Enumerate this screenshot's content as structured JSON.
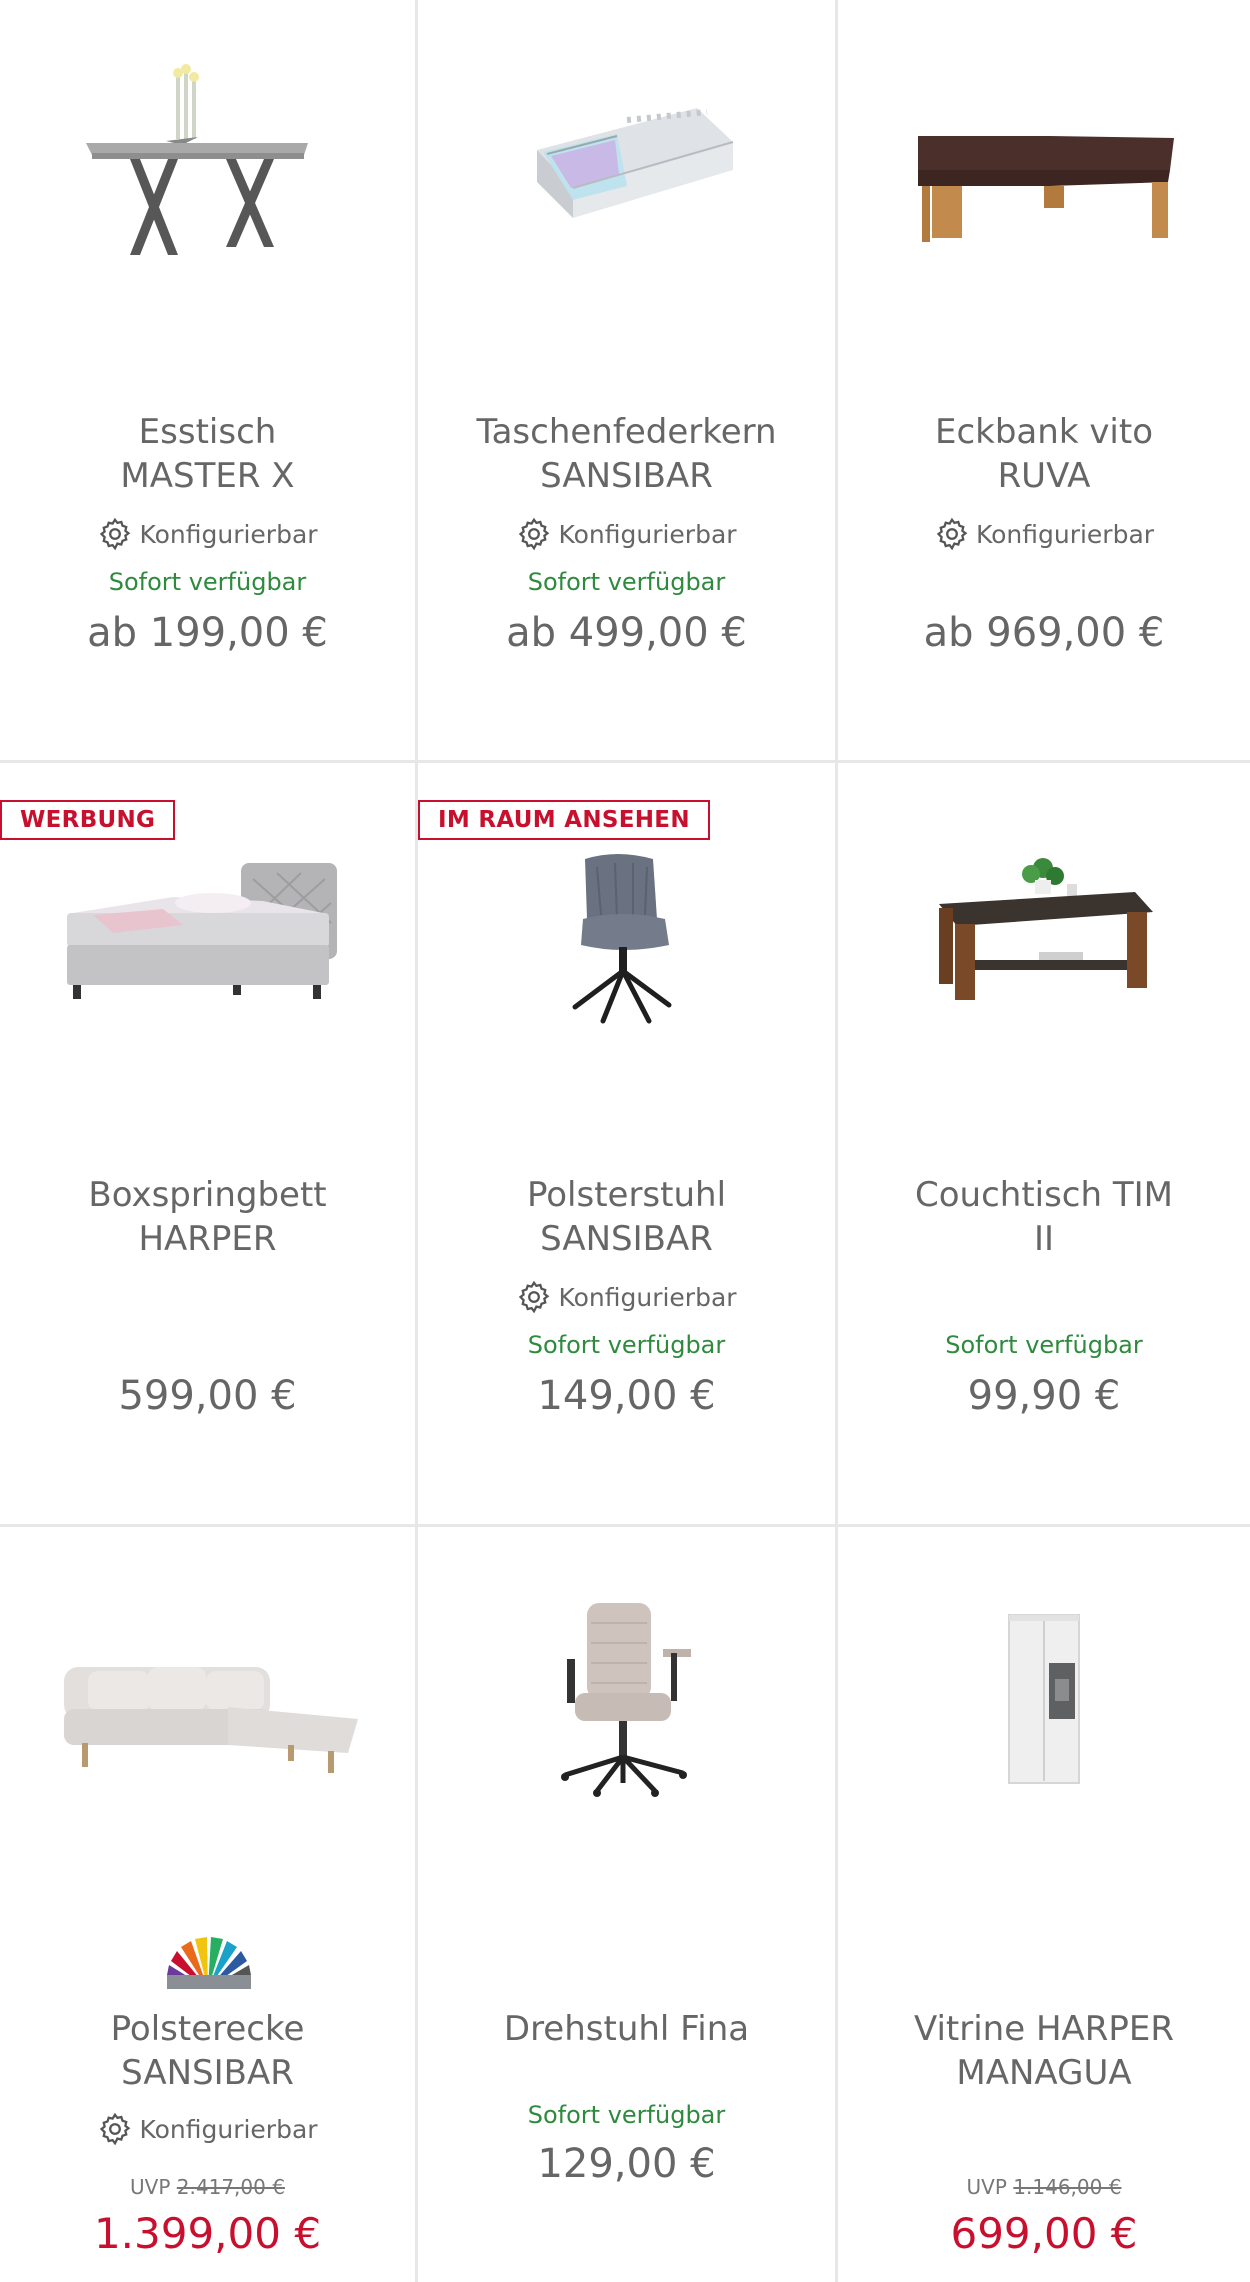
{
  "products": [
    {
      "title_line1": "Esstisch",
      "title_line2": "MASTER X",
      "config": "Konfigurierbar",
      "availability": "Sofort verfügbar",
      "price": "ab 199,00 €"
    },
    {
      "title_line1": "Taschenfederkern",
      "title_line2": "SANSIBAR",
      "config": "Konfigurierbar",
      "availability": "Sofort verfügbar",
      "price": "ab 499,00 €"
    },
    {
      "title_line1": "Eckbank vito",
      "title_line2": "RUVA",
      "config": "Konfigurierbar",
      "price": "ab 969,00 €"
    },
    {
      "badge": "WERBUNG",
      "title_line1": "Boxspringbett",
      "title_line2": "HARPER",
      "price": "599,00 €"
    },
    {
      "badge": "IM RAUM ANSEHEN",
      "title_line1": "Polsterstuhl",
      "title_line2": "SANSIBAR",
      "config": "Konfigurierbar",
      "availability": "Sofort verfügbar",
      "price": "149,00 €"
    },
    {
      "title_line1": "Couchtisch TIM",
      "title_line2": "II",
      "availability": "Sofort verfügbar",
      "price": "99,90 €"
    },
    {
      "title_line1": "Polsterecke",
      "title_line2": "SANSIBAR",
      "config": "Konfigurierbar",
      "uvp_label": "UVP",
      "uvp_old": "2.417,00 €",
      "sale_price": "1.399,00 €"
    },
    {
      "title_line1": "Drehstuhl Fina",
      "availability": "Sofort verfügbar",
      "price": "129,00 €"
    },
    {
      "title_line1": "Vitrine HARPER",
      "title_line2": "MANAGUA",
      "uvp_label": "UVP",
      "uvp_old": "1.146,00 €",
      "sale_price": "699,00 €"
    }
  ],
  "colors": {
    "accent_red": "#c8102e",
    "available_green": "#2e8b3e",
    "divider": "#e6e7e9"
  },
  "icons": {
    "config": "gear-icon",
    "color_variants": "color-fan-icon"
  }
}
